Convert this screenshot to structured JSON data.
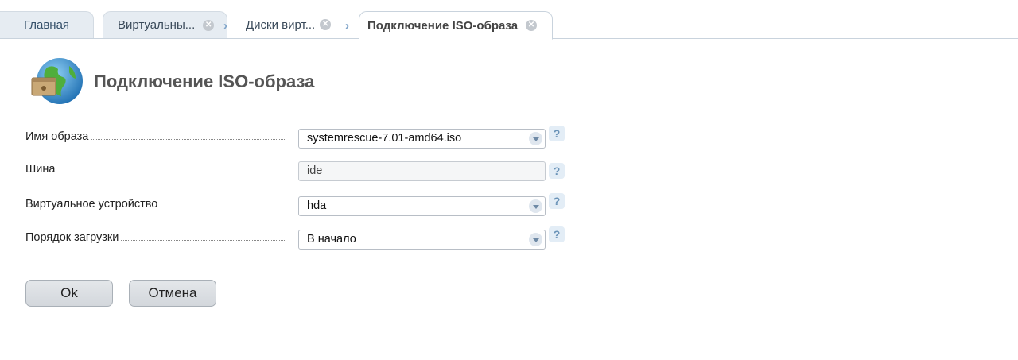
{
  "tabs": {
    "home": "Главная",
    "t1": "Виртуальны...",
    "t2": "Диски вирт...",
    "active": "Подключение ISO-образа"
  },
  "header": {
    "title": "Подключение ISO-образа",
    "icon": "globe-disk-icon"
  },
  "form": {
    "image_name": {
      "label": "Имя образа",
      "value": "systemrescue-7.01-amd64.iso"
    },
    "bus": {
      "label": "Шина",
      "value": "ide"
    },
    "device": {
      "label": "Виртуальное устройство",
      "value": "hda"
    },
    "boot_order": {
      "label": "Порядок загрузки",
      "value": "В начало"
    },
    "help_symbol": "?"
  },
  "buttons": {
    "ok": "Ok",
    "cancel": "Отмена"
  },
  "colors": {
    "accent": "#7ea3c8",
    "tab_bg": "#e6ecf2"
  }
}
